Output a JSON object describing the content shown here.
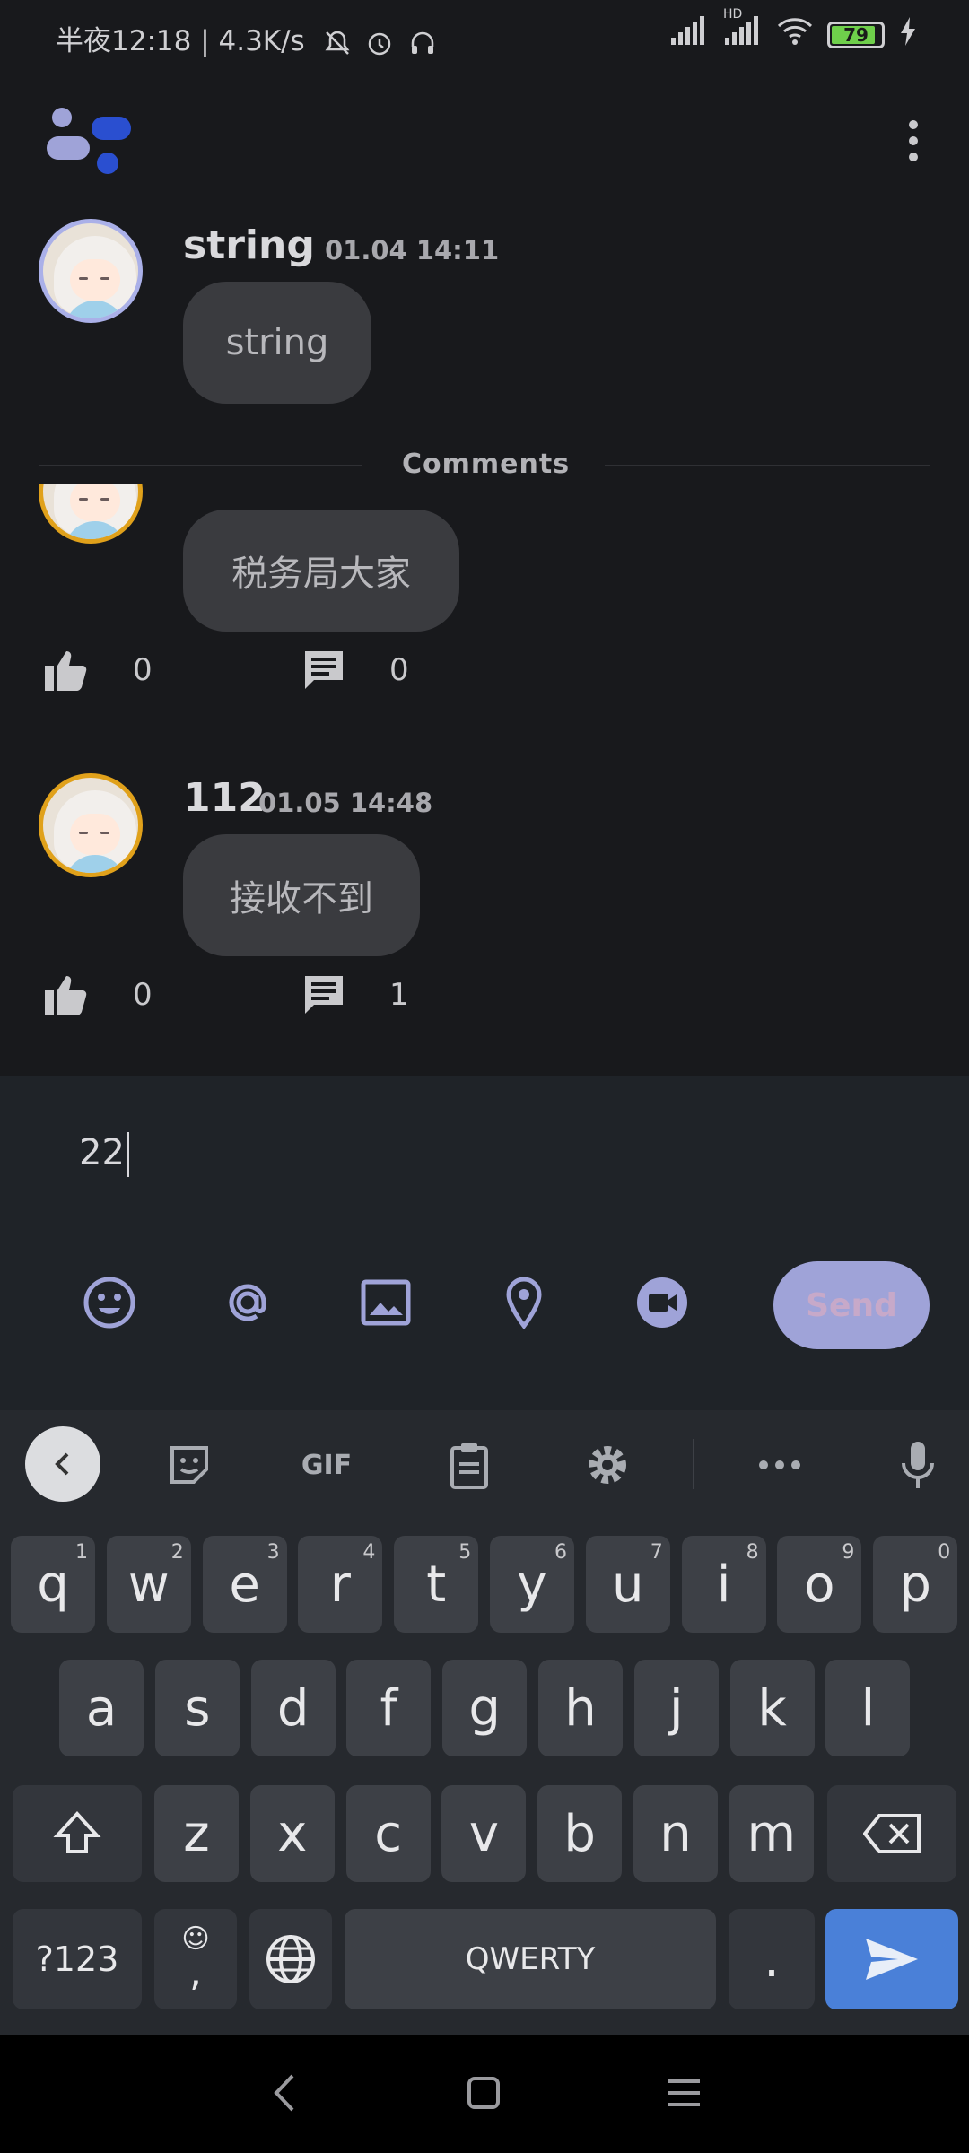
{
  "status_bar": {
    "left_text": "半夜12:18 | 4.3K/s",
    "battery": "79",
    "hd": "HD"
  },
  "post": {
    "author": "string",
    "time": "01.04 14:11",
    "content": "string"
  },
  "comments_label": "Comments",
  "comments": [
    {
      "content": "税务局大家",
      "likes": "0",
      "replies": "0"
    },
    {
      "author": "112",
      "time": "01.05 14:48",
      "content": "接收不到",
      "likes": "0",
      "replies": "1"
    }
  ],
  "composer": {
    "input_value": "22",
    "send_label": "Send"
  },
  "keyboard": {
    "gif_label": "GIF",
    "row1": [
      "q",
      "w",
      "e",
      "r",
      "t",
      "y",
      "u",
      "i",
      "o",
      "p"
    ],
    "row1_sup": [
      "1",
      "2",
      "3",
      "4",
      "5",
      "6",
      "7",
      "8",
      "9",
      "0"
    ],
    "row2": [
      "a",
      "s",
      "d",
      "f",
      "g",
      "h",
      "j",
      "k",
      "l"
    ],
    "row3": [
      "z",
      "x",
      "c",
      "v",
      "b",
      "n",
      "m"
    ],
    "symbols_label": "?123",
    "comma_label": ",",
    "space_label": "QWERTY",
    "period_label": "."
  },
  "colors": {
    "accent": "#9fa3d8",
    "gold_ring": "#e0a11b",
    "blue_ring": "#aab0e8",
    "enter_key": "#4a80d8"
  }
}
